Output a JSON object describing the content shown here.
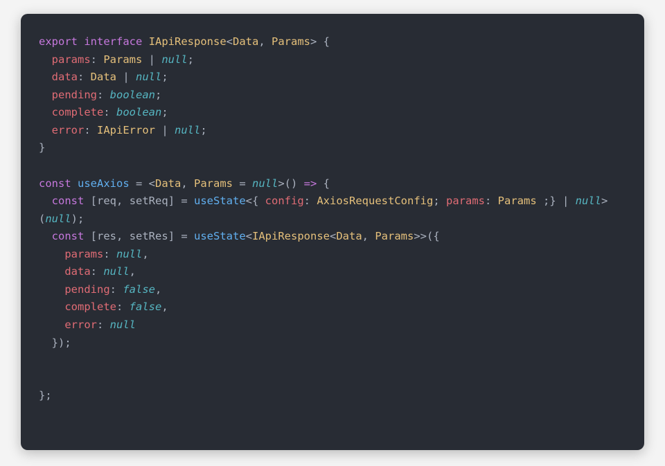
{
  "code": {
    "lines": [
      [
        {
          "t": "export",
          "c": "c-kw"
        },
        {
          "t": " ",
          "c": ""
        },
        {
          "t": "interface",
          "c": "c-kw"
        },
        {
          "t": " ",
          "c": ""
        },
        {
          "t": "IApiResponse",
          "c": "c-type"
        },
        {
          "t": "<",
          "c": "c-punc"
        },
        {
          "t": "Data",
          "c": "c-gen"
        },
        {
          "t": ", ",
          "c": "c-punc"
        },
        {
          "t": "Params",
          "c": "c-gen"
        },
        {
          "t": "> {",
          "c": "c-punc"
        }
      ],
      [
        {
          "t": "  ",
          "c": ""
        },
        {
          "t": "params",
          "c": "c-attr"
        },
        {
          "t": ": ",
          "c": "c-punc"
        },
        {
          "t": "Params",
          "c": "c-gen"
        },
        {
          "t": " | ",
          "c": "c-punc"
        },
        {
          "t": "null",
          "c": "c-null"
        },
        {
          "t": ";",
          "c": "c-punc"
        }
      ],
      [
        {
          "t": "  ",
          "c": ""
        },
        {
          "t": "data",
          "c": "c-attr"
        },
        {
          "t": ": ",
          "c": "c-punc"
        },
        {
          "t": "Data",
          "c": "c-gen"
        },
        {
          "t": " | ",
          "c": "c-punc"
        },
        {
          "t": "null",
          "c": "c-null"
        },
        {
          "t": ";",
          "c": "c-punc"
        }
      ],
      [
        {
          "t": "  ",
          "c": ""
        },
        {
          "t": "pending",
          "c": "c-attr"
        },
        {
          "t": ": ",
          "c": "c-punc"
        },
        {
          "t": "boolean",
          "c": "c-null"
        },
        {
          "t": ";",
          "c": "c-punc"
        }
      ],
      [
        {
          "t": "  ",
          "c": ""
        },
        {
          "t": "complete",
          "c": "c-attr"
        },
        {
          "t": ": ",
          "c": "c-punc"
        },
        {
          "t": "boolean",
          "c": "c-null"
        },
        {
          "t": ";",
          "c": "c-punc"
        }
      ],
      [
        {
          "t": "  ",
          "c": ""
        },
        {
          "t": "error",
          "c": "c-attr"
        },
        {
          "t": ": ",
          "c": "c-punc"
        },
        {
          "t": "IApiError",
          "c": "c-type"
        },
        {
          "t": " | ",
          "c": "c-punc"
        },
        {
          "t": "null",
          "c": "c-null"
        },
        {
          "t": ";",
          "c": "c-punc"
        }
      ],
      [
        {
          "t": "}",
          "c": "c-punc"
        }
      ],
      [
        {
          "t": " ",
          "c": ""
        }
      ],
      [
        {
          "t": "const",
          "c": "c-kw"
        },
        {
          "t": " ",
          "c": ""
        },
        {
          "t": "useAxios",
          "c": "c-func"
        },
        {
          "t": " = <",
          "c": "c-punc"
        },
        {
          "t": "Data",
          "c": "c-gen"
        },
        {
          "t": ", ",
          "c": "c-punc"
        },
        {
          "t": "Params",
          "c": "c-gen"
        },
        {
          "t": " = ",
          "c": "c-punc"
        },
        {
          "t": "null",
          "c": "c-null"
        },
        {
          "t": ">() ",
          "c": "c-punc"
        },
        {
          "t": "=>",
          "c": "c-kw"
        },
        {
          "t": " {",
          "c": "c-punc"
        }
      ],
      [
        {
          "t": "  ",
          "c": ""
        },
        {
          "t": "const",
          "c": "c-kw"
        },
        {
          "t": " [",
          "c": "c-punc"
        },
        {
          "t": "req",
          "c": "c-var"
        },
        {
          "t": ", ",
          "c": "c-punc"
        },
        {
          "t": "setReq",
          "c": "c-var"
        },
        {
          "t": "] = ",
          "c": "c-punc"
        },
        {
          "t": "useState",
          "c": "c-func"
        },
        {
          "t": "<{ ",
          "c": "c-punc"
        },
        {
          "t": "config",
          "c": "c-attr"
        },
        {
          "t": ": ",
          "c": "c-punc"
        },
        {
          "t": "AxiosRequestConfig",
          "c": "c-type"
        },
        {
          "t": "; ",
          "c": "c-punc"
        },
        {
          "t": "params",
          "c": "c-attr"
        },
        {
          "t": ": ",
          "c": "c-punc"
        },
        {
          "t": "Params ",
          "c": "c-gen"
        },
        {
          "t": ";} | ",
          "c": "c-punc"
        },
        {
          "t": "null",
          "c": "c-null"
        },
        {
          "t": ">(",
          "c": "c-punc"
        },
        {
          "t": "null",
          "c": "c-null"
        },
        {
          "t": ");",
          "c": "c-punc"
        }
      ],
      [
        {
          "t": "  ",
          "c": ""
        },
        {
          "t": "const",
          "c": "c-kw"
        },
        {
          "t": " [",
          "c": "c-punc"
        },
        {
          "t": "res",
          "c": "c-var"
        },
        {
          "t": ", ",
          "c": "c-punc"
        },
        {
          "t": "setRes",
          "c": "c-var"
        },
        {
          "t": "] = ",
          "c": "c-punc"
        },
        {
          "t": "useState",
          "c": "c-func"
        },
        {
          "t": "<",
          "c": "c-punc"
        },
        {
          "t": "IApiResponse",
          "c": "c-type"
        },
        {
          "t": "<",
          "c": "c-punc"
        },
        {
          "t": "Data",
          "c": "c-gen"
        },
        {
          "t": ", ",
          "c": "c-punc"
        },
        {
          "t": "Params",
          "c": "c-gen"
        },
        {
          "t": ">>({",
          "c": "c-punc"
        }
      ],
      [
        {
          "t": "    ",
          "c": ""
        },
        {
          "t": "params",
          "c": "c-attr"
        },
        {
          "t": ": ",
          "c": "c-punc"
        },
        {
          "t": "null",
          "c": "c-null"
        },
        {
          "t": ",",
          "c": "c-punc"
        }
      ],
      [
        {
          "t": "    ",
          "c": ""
        },
        {
          "t": "data",
          "c": "c-attr"
        },
        {
          "t": ": ",
          "c": "c-punc"
        },
        {
          "t": "null",
          "c": "c-null"
        },
        {
          "t": ",",
          "c": "c-punc"
        }
      ],
      [
        {
          "t": "    ",
          "c": ""
        },
        {
          "t": "pending",
          "c": "c-attr"
        },
        {
          "t": ": ",
          "c": "c-punc"
        },
        {
          "t": "false",
          "c": "c-null"
        },
        {
          "t": ",",
          "c": "c-punc"
        }
      ],
      [
        {
          "t": "    ",
          "c": ""
        },
        {
          "t": "complete",
          "c": "c-attr"
        },
        {
          "t": ": ",
          "c": "c-punc"
        },
        {
          "t": "false",
          "c": "c-null"
        },
        {
          "t": ",",
          "c": "c-punc"
        }
      ],
      [
        {
          "t": "    ",
          "c": ""
        },
        {
          "t": "error",
          "c": "c-attr"
        },
        {
          "t": ": ",
          "c": "c-punc"
        },
        {
          "t": "null",
          "c": "c-null"
        }
      ],
      [
        {
          "t": "  });",
          "c": "c-punc"
        }
      ],
      [
        {
          "t": " ",
          "c": ""
        }
      ],
      [
        {
          "t": " ",
          "c": ""
        }
      ],
      [
        {
          "t": "};",
          "c": "c-punc"
        }
      ]
    ]
  }
}
